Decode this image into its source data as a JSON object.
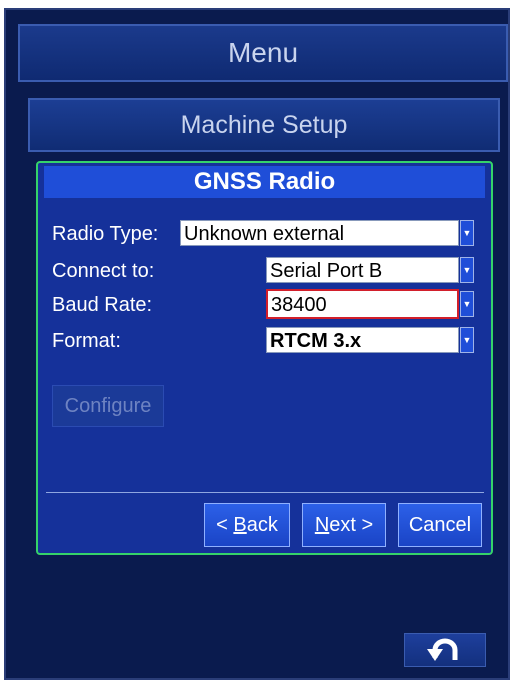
{
  "header": {
    "title": "Menu"
  },
  "section": {
    "title": "Machine Setup"
  },
  "dialog": {
    "title": "GNSS Radio",
    "fields": {
      "radio_type": {
        "label": "Radio Type:",
        "value": "Unknown external"
      },
      "connect_to": {
        "label": "Connect to:",
        "value": "Serial Port B"
      },
      "baud_rate": {
        "label": "Baud Rate:",
        "value": "38400"
      },
      "format": {
        "label": "Format:",
        "value": "RTCM 3.x"
      }
    },
    "configure_label": "Configure",
    "buttons": {
      "back": {
        "prefix": "< ",
        "underline": "B",
        "rest": "ack"
      },
      "next": {
        "underline": "N",
        "rest": "ext >"
      },
      "cancel": "Cancel"
    }
  },
  "colors": {
    "background": "#0a1b4e",
    "dialog": "#15319a",
    "dialog_border": "#35d36a",
    "focus": "#d21f2b",
    "title_bar": "#1f4ed8"
  },
  "icons": {
    "back": "undo-arrow-icon",
    "dropdown": "dropdown-arrow-icon"
  }
}
